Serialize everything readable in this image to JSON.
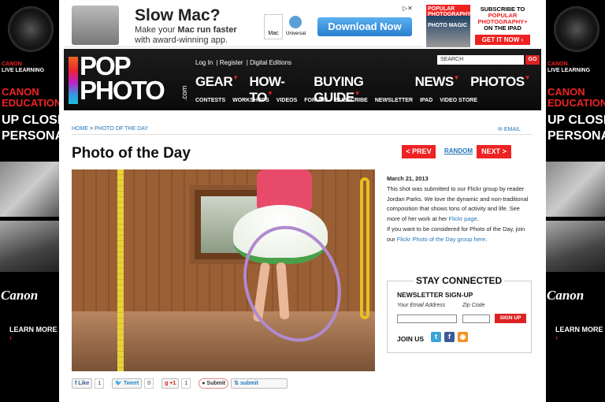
{
  "side_ad": {
    "brand_line1": "CANON",
    "brand_line2": "LIVE LEARNING",
    "education": "CANON EDUCATION",
    "headline": "UP CLOSE PERSONAL",
    "logo": "Canon",
    "cta": "LEARN MORE"
  },
  "top_ad": {
    "headline": "Slow Mac?",
    "body_prefix": "Make your ",
    "body_bold": "Mac run faster",
    "body_suffix": " with award-winning app.",
    "mac_label": "Mac",
    "universal_label": "Universal",
    "button": "Download Now",
    "mag_title": "POPULAR PHOTOGRAPHY",
    "mag_sub": "PHOTO MAGIC",
    "subscribe_line1": "SUBSCRIBE TO",
    "subscribe_line2": "POPULAR PHOTOGRAPHY+",
    "subscribe_line3": "ON THE IPAD",
    "get_it": "GET IT NOW"
  },
  "header": {
    "logo_pop": "POP",
    "logo_photo": "PHOTO",
    "logo_com": ".com",
    "top_links": [
      "Log In",
      "Register",
      "Digital Editions"
    ],
    "search_placeholder": "SEARCH",
    "search_go": "GO",
    "main_nav": [
      "GEAR",
      "HOW-TO",
      "BUYING GUIDE",
      "NEWS",
      "PHOTOS"
    ],
    "sub_nav": [
      "CONTESTS",
      "WORKSHOPS",
      "VIDEOS",
      "FORUMS",
      "SUBSCRIBE",
      "NEWSLETTER",
      "IPAD",
      "VIDEO STORE"
    ]
  },
  "breadcrumb": {
    "home": "HOME",
    "sep": " > ",
    "current": "PHOTO OF THE DAY"
  },
  "email_link": "EMAIL",
  "page_title": "Photo of the Day",
  "pager": {
    "prev": "< PREV",
    "random": "RANDOM",
    "next": "NEXT >"
  },
  "caption": {
    "date": "March 21, 2013",
    "text1": "This shot was submitted to our Flickr group by reader Jordan Parks. We love the dynamic and non-traditional composition that shows tons of activity and life. See more of her work at her ",
    "link1": "Flickr page",
    "text2": ".",
    "text3": "If you want to be considered for Photo of the Day, join our ",
    "link2": "Flickr Photo of the Day group here",
    "text4": "."
  },
  "stay_connected": {
    "title": "STAY CONNECTED",
    "newsletter": "NEWSLETTER SIGN-UP",
    "email_label": "Your Email Address",
    "zip_label": "Zip Code",
    "signup": "SIGN UP",
    "join_us": "JOIN US"
  },
  "share": {
    "like": "Like",
    "like_count": "1",
    "tweet": "Tweet",
    "tweet_count": "0",
    "gplus": "+1",
    "gplus_count": "1",
    "stumble": "Submit",
    "reddit": "submit"
  }
}
